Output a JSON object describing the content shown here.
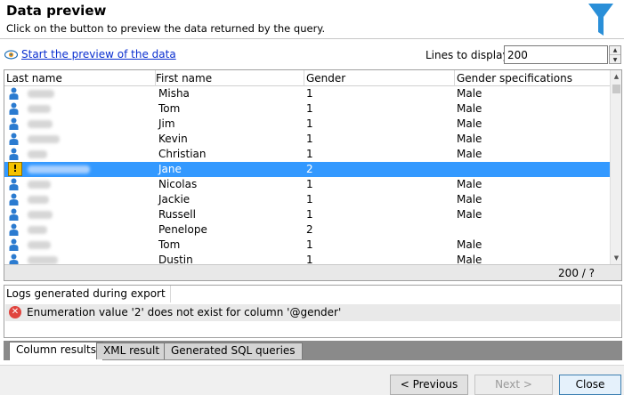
{
  "header": {
    "title": "Data preview",
    "subtitle": "Click on the button to preview the data returned by the query."
  },
  "toolbar": {
    "preview_link": "Start the preview of the data",
    "lines_label": "Lines to display:",
    "lines_value": "200"
  },
  "grid": {
    "columns": [
      "Last name",
      "First name",
      "Gender",
      "Gender specifications"
    ],
    "rows": [
      {
        "first": "Misha",
        "gender": "1",
        "spec": "Male",
        "icon": "person-icon"
      },
      {
        "first": "Tom",
        "gender": "1",
        "spec": "Male",
        "icon": "person-icon"
      },
      {
        "first": "Jim",
        "gender": "1",
        "spec": "Male",
        "icon": "person-icon"
      },
      {
        "first": "Kevin",
        "gender": "1",
        "spec": "Male",
        "icon": "person-icon"
      },
      {
        "first": "Christian",
        "gender": "1",
        "spec": "Male",
        "icon": "person-icon"
      },
      {
        "first": "Jane",
        "gender": "2",
        "spec": "",
        "icon": "warning-icon",
        "selected": true
      },
      {
        "first": "Nicolas",
        "gender": "1",
        "spec": "Male",
        "icon": "person-icon"
      },
      {
        "first": "Jackie",
        "gender": "1",
        "spec": "Male",
        "icon": "person-icon"
      },
      {
        "first": "Russell",
        "gender": "1",
        "spec": "Male",
        "icon": "person-icon"
      },
      {
        "first": "Penelope",
        "gender": "2",
        "spec": "",
        "icon": "person-icon"
      },
      {
        "first": "Tom",
        "gender": "1",
        "spec": "Male",
        "icon": "person-icon"
      },
      {
        "first": "Dustin",
        "gender": "1",
        "spec": "Male",
        "icon": "person-icon"
      }
    ],
    "status": "200 / ?"
  },
  "log": {
    "header": "Logs generated during export",
    "message": "Enumeration value '2' does not exist for column '@gender'"
  },
  "tabs": [
    "Column results",
    "XML result",
    "Generated SQL queries"
  ],
  "buttons": {
    "previous": "< Previous",
    "next": "Next >",
    "close": "Close"
  },
  "colors": {
    "accent": "#2a8fd8",
    "selection": "#3399ff",
    "link": "#0a2fd0",
    "error": "#e0443e",
    "warning": "#f5c200"
  }
}
